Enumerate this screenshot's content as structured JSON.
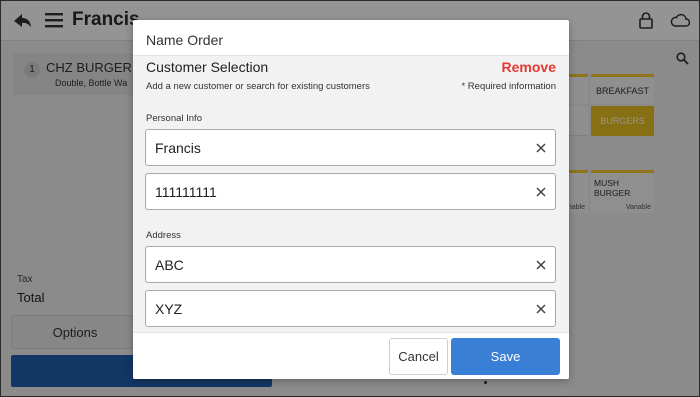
{
  "app": {
    "title": "Francis",
    "icons": {
      "back": "back-arrow-icon",
      "menu": "hamburger-menu-icon",
      "lock": "lock-icon",
      "cloud": "cloud-icon",
      "search": "search-icon"
    }
  },
  "order": {
    "items": [
      {
        "qty": "1",
        "name": "CHZ BURGER",
        "modifiers": "Double, Bottle Wa"
      }
    ],
    "tax_label": "Tax",
    "total_label": "Total",
    "options_label": "Options"
  },
  "menu": {
    "tiles": [
      {
        "label": "BREAKFAST"
      },
      {
        "label": "BURGERS",
        "color": "#e9c221"
      },
      {
        "label": "MUSH BURGER",
        "note": "Variable"
      }
    ],
    "left_tile_note": "riable"
  },
  "modal": {
    "title": "Name Order",
    "section_title": "Customer Selection",
    "remove_label": "Remove",
    "subtitle": "Add a new customer or search for existing customers",
    "required_note": "* Required information",
    "personal_info_label": "Personal Info",
    "address_label": "Address",
    "fields": {
      "name": "Francis",
      "phone": "111111111",
      "address_line1": "ABC",
      "address_line2": "XYZ"
    },
    "cancel_label": "Cancel",
    "save_label": "Save"
  },
  "colors": {
    "remove": "#e53935",
    "save_button": "#3a7fd6",
    "pay_button": "#1f5fae",
    "category_accent": "#f4c82e"
  }
}
